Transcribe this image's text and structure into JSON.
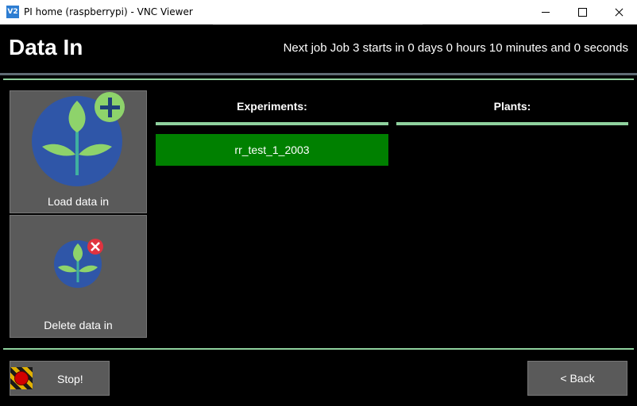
{
  "window": {
    "title": "PI home (raspberrypi) - VNC Viewer",
    "app_icon_text": "V2"
  },
  "header": {
    "title": "Data In",
    "next_job": "Next job Job 3 starts in 0 days 0 hours 10 minutes and 0 seconds"
  },
  "sidebar": {
    "load_label": "Load data in",
    "delete_label": "Delete data in"
  },
  "columns": {
    "experiments_header": "Experiments:",
    "plants_header": "Plants:",
    "experiments": [
      "rr_test_1_2003"
    ]
  },
  "footer": {
    "stop_label": "Stop!",
    "back_label": "< Back"
  },
  "colors": {
    "accent_green_rule": "#8fd19e",
    "selected_item": "#008000",
    "button_grey": "#5a5a5a",
    "plant_circle": "#2f56a8",
    "leaf_green": "#8ed36b",
    "add_badge": "#8ed36b",
    "delete_badge": "#e0333f"
  }
}
